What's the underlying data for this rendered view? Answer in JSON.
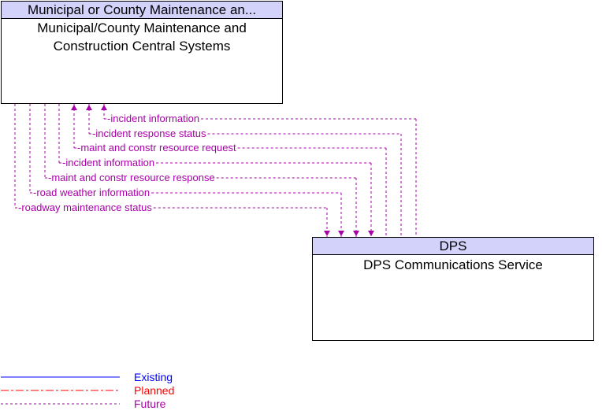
{
  "nodes": {
    "source": {
      "header": "Municipal or County Maintenance an...",
      "title": "Municipal/County Maintenance and Construction Central Systems"
    },
    "target": {
      "header": "DPS",
      "title": "DPS Communications Service"
    }
  },
  "flows": [
    {
      "label": "incident information",
      "direction": "to-source",
      "status": "Future"
    },
    {
      "label": "incident response status",
      "direction": "to-source",
      "status": "Future"
    },
    {
      "label": "maint and constr resource request",
      "direction": "to-source",
      "status": "Future"
    },
    {
      "label": "incident information",
      "direction": "to-target",
      "status": "Future"
    },
    {
      "label": "maint and constr resource response",
      "direction": "to-target",
      "status": "Future"
    },
    {
      "label": "road weather information",
      "direction": "to-target",
      "status": "Future"
    },
    {
      "label": "roadway maintenance status",
      "direction": "to-target",
      "status": "Future"
    }
  ],
  "legend": [
    {
      "label": "Existing",
      "color": "#0000ff"
    },
    {
      "label": "Planned",
      "color": "#ff0000"
    },
    {
      "label": "Future",
      "color": "#a800a8"
    }
  ],
  "colors": {
    "flow": "#a800a8",
    "header_bg": "#d2d2fa"
  }
}
